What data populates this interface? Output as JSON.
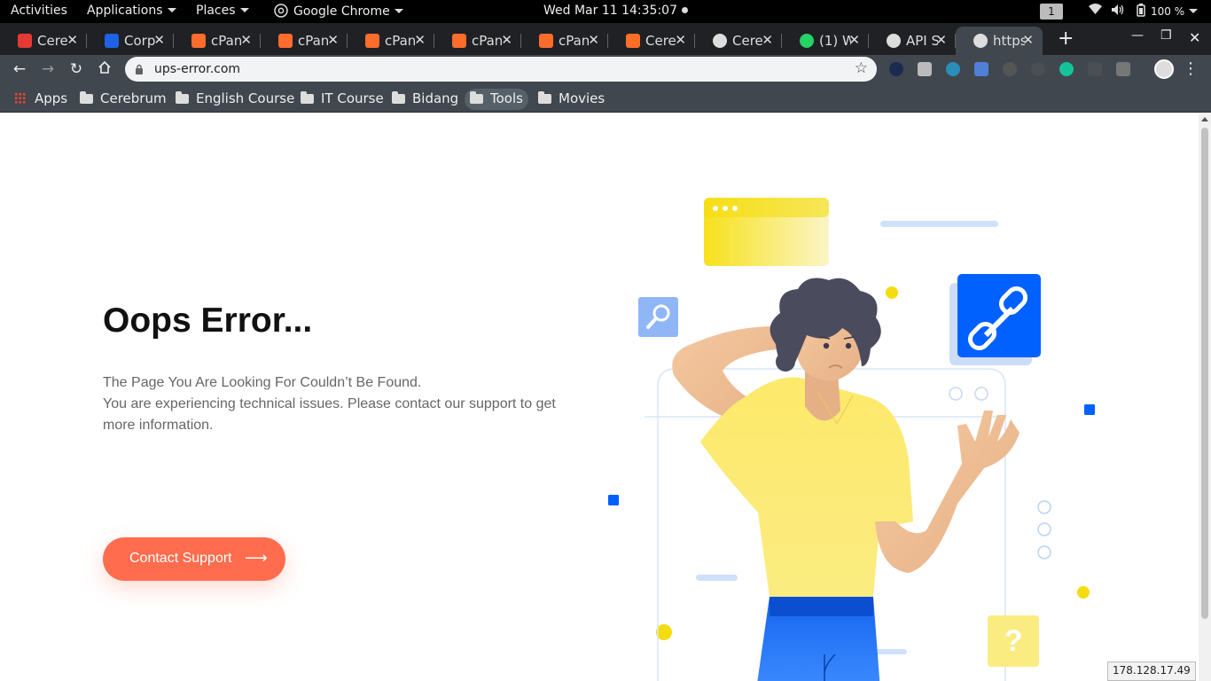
{
  "system_bar": {
    "activities": "Activities",
    "applications": "Applications",
    "places": "Places",
    "app_name": "Google Chrome",
    "clock": "Wed Mar 11  14:35:07",
    "workspace": "1",
    "battery": "100 %"
  },
  "tabs": [
    {
      "title": "Cere",
      "favicon": "cerebrum-icon",
      "color": "#e53935"
    },
    {
      "title": "Corp",
      "favicon": "corp-icon",
      "color": "#1e62e6"
    },
    {
      "title": "cPan",
      "favicon": "cpanel-icon",
      "color": "#ff6c2c"
    },
    {
      "title": "cPan",
      "favicon": "cpanel-icon",
      "color": "#ff6c2c"
    },
    {
      "title": "cPan",
      "favicon": "cpanel-icon",
      "color": "#ff6c2c"
    },
    {
      "title": "cPan",
      "favicon": "cpanel-icon",
      "color": "#ff6c2c"
    },
    {
      "title": "cPan",
      "favicon": "cpanel-icon",
      "color": "#ff6c2c"
    },
    {
      "title": "Cere",
      "favicon": "gitlab-icon",
      "color": "#fc6d26"
    },
    {
      "title": "Cere",
      "favicon": "globe-icon",
      "color": "#dddddd"
    },
    {
      "title": "(1) W",
      "favicon": "whatsapp-icon",
      "color": "#25d366"
    },
    {
      "title": "API S",
      "favicon": "globe-icon",
      "color": "#dddddd"
    },
    {
      "title": "https",
      "favicon": "globe-icon",
      "color": "#dddddd",
      "active": true
    }
  ],
  "toolbar": {
    "url": "ups-error.com"
  },
  "bookmarks": {
    "apps": "Apps",
    "items": [
      "Cerebrum",
      "English Course",
      "IT Course",
      "Bidang",
      "Tools",
      "Movies"
    ]
  },
  "content": {
    "heading": "Oops Error...",
    "line1": "The Page You Are Looking For Couldn’t Be Found.",
    "line2": "You are experiencing technical issues. Please contact our support to get more information.",
    "button_label": "Contact Support",
    "question_mark": "?"
  },
  "status_ip": "178.128.17.49",
  "colors": {
    "accent": "#ff6d4e",
    "link_blue": "#0061ff",
    "shirt_yellow": "#fbe86a",
    "pants_blue": "#0b5fe6",
    "hair": "#4a4a5a"
  }
}
